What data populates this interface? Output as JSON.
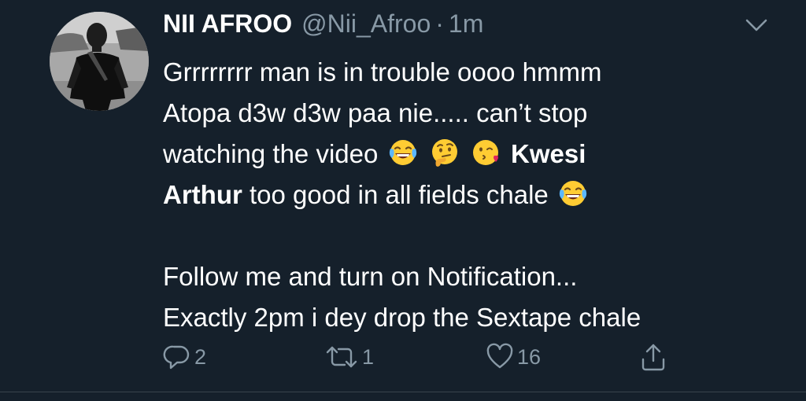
{
  "tweet": {
    "display_name": "NII AFROO",
    "handle": "@Nii_Afroo",
    "separator": "·",
    "timestamp": "1m",
    "avatar_icon": "profile-photo",
    "menu_icon": "chevron-down-icon",
    "text": {
      "line1": "Grrrrrrrr man is in trouble oooo hmmm",
      "line2": "Atopa d3w d3w paa nie..... can’t stop",
      "line3_start": "watching the video",
      "line3_mention": "Kwesi",
      "line4_mention": "Arthur",
      "line4_end": "too good in all fields chale",
      "line5": "Follow me and turn on Notification...",
      "line6": "Exactly 2pm i dey drop the Sextape chale"
    },
    "emojis": [
      "face-with-tears-of-joy",
      "thinking-face",
      "face-blowing-a-kiss",
      "face-with-tears-of-joy"
    ],
    "actions": {
      "reply_count": "2",
      "retweet_count": "1",
      "like_count": "16"
    },
    "colors": {
      "background": "#15202b",
      "text": "#ffffff",
      "secondary": "#8899a6",
      "divider": "#38444d"
    }
  }
}
